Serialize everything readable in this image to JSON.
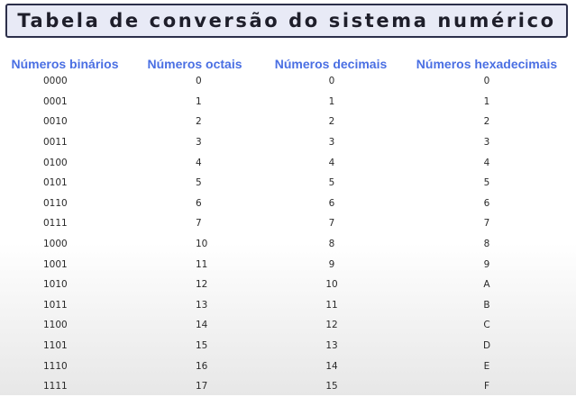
{
  "title": "Tabela de conversão do sistema numérico",
  "headers": [
    "Números binários",
    "Números octais",
    "Números decimais",
    "Números hexadecimais"
  ],
  "rows": [
    {
      "bin": "0000",
      "oct": "0",
      "dec": "0",
      "hex": "0"
    },
    {
      "bin": "0001",
      "oct": "1",
      "dec": "1",
      "hex": "1"
    },
    {
      "bin": "0010",
      "oct": "2",
      "dec": "2",
      "hex": "2"
    },
    {
      "bin": "0011",
      "oct": "3",
      "dec": "3",
      "hex": "3"
    },
    {
      "bin": "0100",
      "oct": "4",
      "dec": "4",
      "hex": "4"
    },
    {
      "bin": "0101",
      "oct": "5",
      "dec": "5",
      "hex": "5"
    },
    {
      "bin": "0110",
      "oct": "6",
      "dec": "6",
      "hex": "6"
    },
    {
      "bin": "0111",
      "oct": "7",
      "dec": "7",
      "hex": "7"
    },
    {
      "bin": "1000",
      "oct": "10",
      "dec": "8",
      "hex": "8"
    },
    {
      "bin": "1001",
      "oct": "11",
      "dec": "9",
      "hex": "9"
    },
    {
      "bin": "1010",
      "oct": "12",
      "dec": "10",
      "hex": "A"
    },
    {
      "bin": "1011",
      "oct": "13",
      "dec": "11",
      "hex": "B"
    },
    {
      "bin": "1100",
      "oct": "14",
      "dec": "12",
      "hex": "C"
    },
    {
      "bin": "1101",
      "oct": "15",
      "dec": "13",
      "hex": "D"
    },
    {
      "bin": "1110",
      "oct": "16",
      "dec": "14",
      "hex": "E"
    },
    {
      "bin": "1111",
      "oct": "17",
      "dec": "15",
      "hex": "F"
    }
  ],
  "colors": {
    "header_text": "#4a6fe3",
    "title_bg": "#e8eaf6",
    "title_border": "#2c2f4a",
    "body_text": "#2a2a2a"
  }
}
